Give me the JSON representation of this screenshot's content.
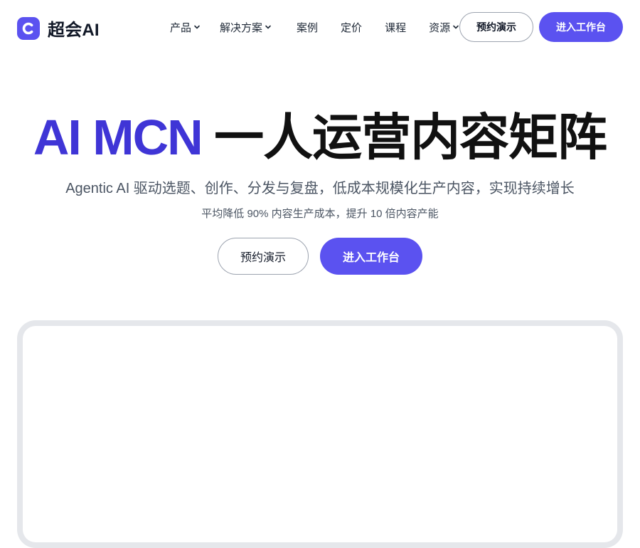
{
  "brand": {
    "name": "超会AI",
    "logo_icon": "c-logo-icon",
    "accent_color": "#5b52f0"
  },
  "nav": {
    "items": [
      {
        "label": "产品",
        "has_dropdown": true
      },
      {
        "label": "解决方案",
        "has_dropdown": true
      },
      {
        "label": "案例",
        "has_dropdown": false
      },
      {
        "label": "定价",
        "has_dropdown": false
      },
      {
        "label": "课程",
        "has_dropdown": false
      },
      {
        "label": "资源",
        "has_dropdown": true
      }
    ],
    "demo_label": "预约演示",
    "workspace_label": "进入工作台"
  },
  "hero": {
    "title_accent": "AI MCN",
    "title_rest": "一人运营内容矩阵",
    "subtitle": "Agentic AI 驱动选题、创作、分发与复盘，低成本规模化生产内容，实现持续增长",
    "note": "平均降低 90% 内容生产成本，提升 10 倍内容产能",
    "demo_label": "预约演示",
    "workspace_label": "进入工作台",
    "title_accent_color": "#3f35d6"
  }
}
